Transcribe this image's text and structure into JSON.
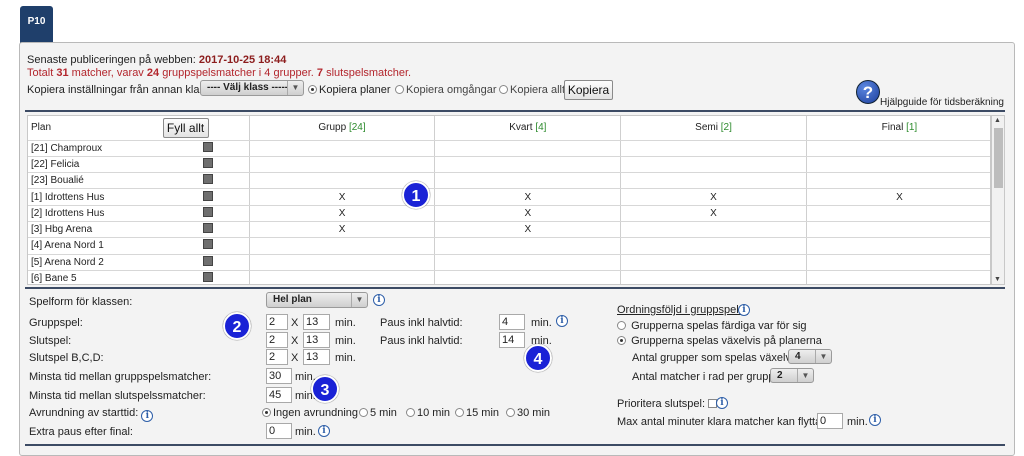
{
  "tab": {
    "label": "P10"
  },
  "header": {
    "published_label": "Senaste publiceringen på webben:",
    "published_value": "2017-10-25 18:44",
    "summary_prefix": "Totalt",
    "total_matches": "31",
    "summary_mid1": "matcher, varav",
    "group_matches": "24",
    "summary_mid2": "gruppspelsmatcher i 4 grupper.",
    "final_matches": "7",
    "summary_end": "slutspelsmatcher."
  },
  "copy": {
    "label": "Kopiera inställningar från annan klass:",
    "select_value": "---- Välj klass -----",
    "opt_plans": "Kopiera planer",
    "opt_rounds": "Kopiera omgångar",
    "opt_all": "Kopiera allt",
    "button": "Kopiera"
  },
  "help_link": "Hjälpguide för tidsberäkning",
  "grid": {
    "plan_header": "Plan",
    "fill_all": "Fyll allt",
    "columns": [
      {
        "name": "Grupp",
        "count": "[24]"
      },
      {
        "name": "Kvart",
        "count": "[4]"
      },
      {
        "name": "Semi",
        "count": "[2]"
      },
      {
        "name": "Final",
        "count": "[1]"
      }
    ],
    "rows": [
      {
        "name": "[21] Champroux",
        "cells": [
          "",
          "",
          "",
          ""
        ]
      },
      {
        "name": "[22] Felicia",
        "cells": [
          "",
          "",
          "",
          ""
        ]
      },
      {
        "name": "[23] Boualié",
        "cells": [
          "",
          "",
          "",
          ""
        ]
      },
      {
        "name": "[1] Idrottens Hus",
        "cells": [
          "X",
          "X",
          "X",
          "X"
        ]
      },
      {
        "name": "[2] Idrottens Hus",
        "cells": [
          "X",
          "X",
          "X",
          ""
        ]
      },
      {
        "name": "[3] Hbg Arena",
        "cells": [
          "X",
          "X",
          "",
          ""
        ]
      },
      {
        "name": "[4] Arena Nord 1",
        "cells": [
          "",
          "",
          "",
          ""
        ]
      },
      {
        "name": "[5] Arena Nord 2",
        "cells": [
          "",
          "",
          "",
          ""
        ]
      },
      {
        "name": "[6] Bane 5",
        "cells": [
          "",
          "",
          "",
          ""
        ]
      }
    ]
  },
  "settings": {
    "spelform_label": "Spelform för klassen:",
    "spelform_value": "Hel plan",
    "gruppspel_label": "Gruppspel:",
    "gruppspel_a": "2",
    "gruppspel_b": "13",
    "slutspel_label": "Slutspel:",
    "slutspel_a": "2",
    "slutspel_b": "13",
    "slutspel_bcd_label": "Slutspel B,C,D:",
    "bcd_a": "2",
    "bcd_b": "13",
    "x": "X",
    "min": "min.",
    "minsta_grupp_label": "Minsta tid mellan gruppspelsmatcher:",
    "minsta_grupp_value": "30",
    "minsta_slut_label": "Minsta tid mellan slutspelssmatcher:",
    "minsta_slut_value": "45",
    "avrundning_label": "Avrundning av starttid:",
    "avrundning_options": [
      "Ingen avrundning",
      "5 min",
      "10 min",
      "15 min",
      "30 min"
    ],
    "extra_label": "Extra paus efter final:",
    "extra_value": "0",
    "paus1_label": "Paus inkl halvtid:",
    "paus1_value": "4",
    "paus2_label": "Paus inkl halvtid:",
    "paus2_value": "14"
  },
  "order": {
    "title": "Ordningsföljd i gruppspelet",
    "opt1": "Grupperna spelas färdiga var för sig",
    "opt2": "Grupperna spelas växelvis på planerna",
    "groups_label": "Antal grupper som spelas växelvis:",
    "groups_value": "4",
    "rows_label": "Antal matcher i rad per grupp:",
    "rows_value": "2",
    "prioritera_label": "Prioritera slutspel:",
    "max_label": "Max antal minuter klara matcher kan flyttas:",
    "max_value": "0"
  },
  "badges": [
    "1",
    "2",
    "3",
    "4"
  ]
}
